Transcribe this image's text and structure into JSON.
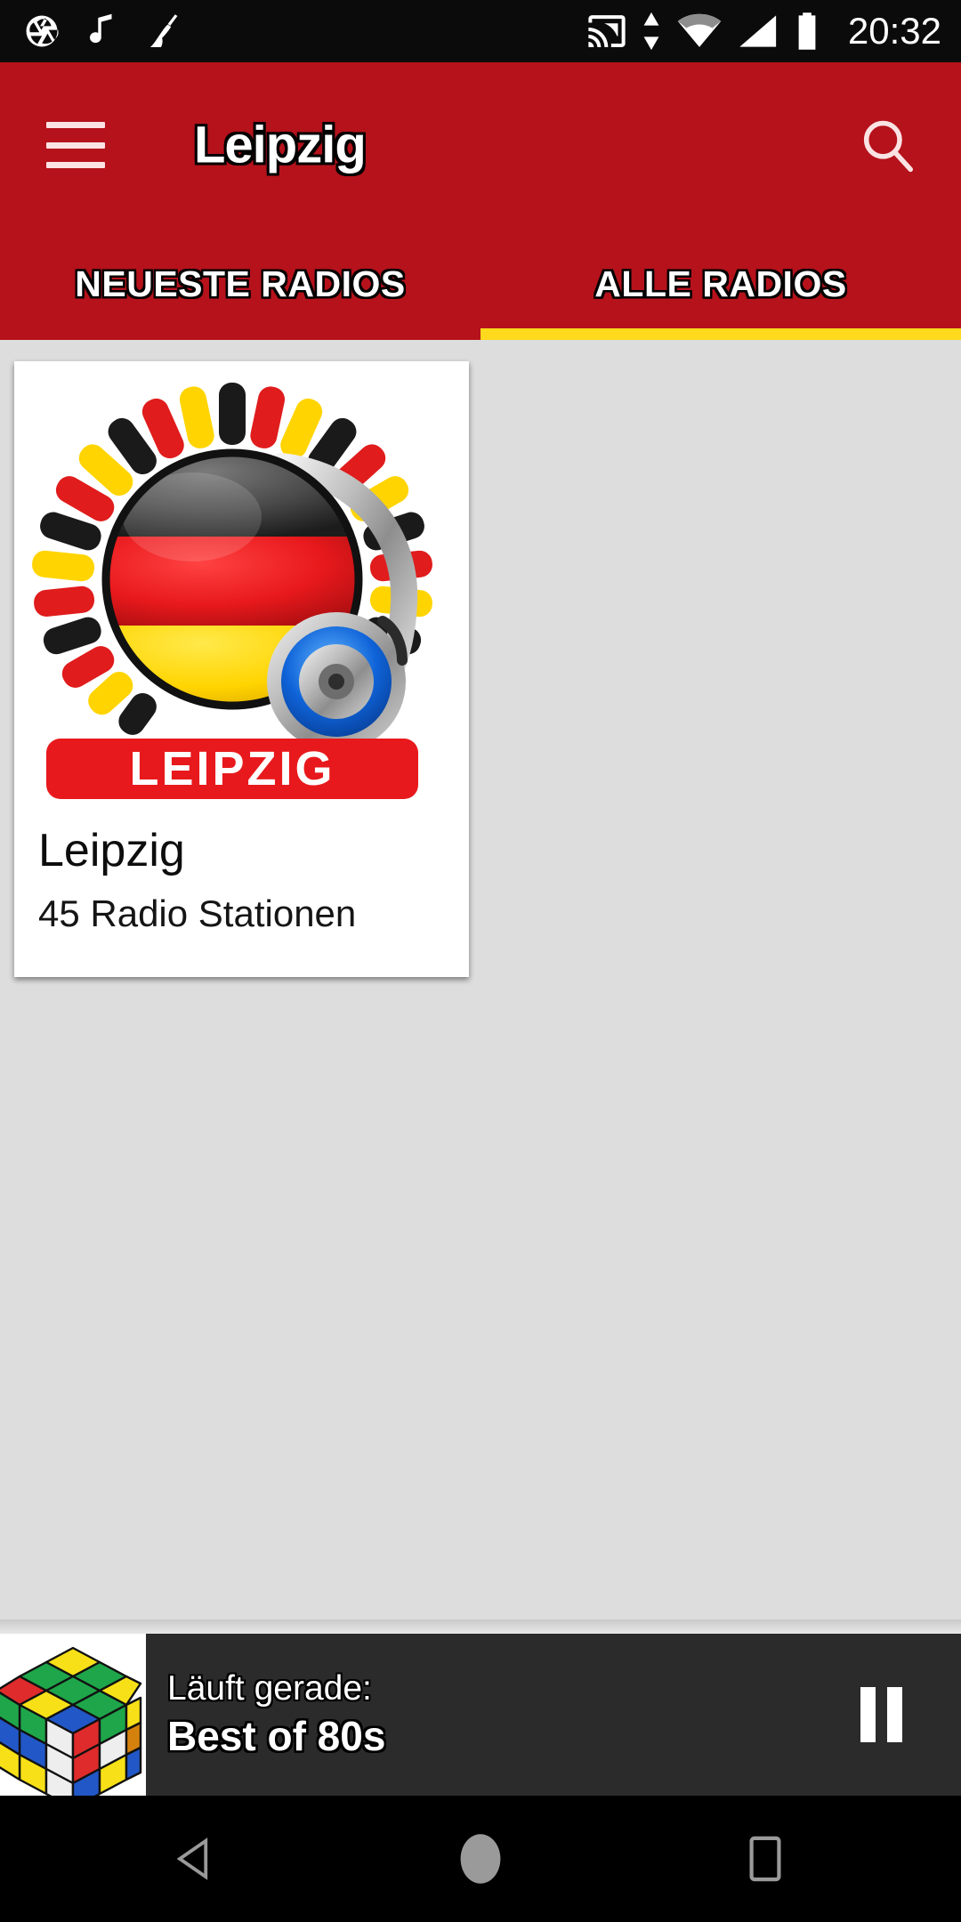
{
  "statusbar": {
    "left_icons": [
      "camera-aperture-icon",
      "music-note-icon",
      "broom-cleaner-icon"
    ],
    "right_icons": [
      "cast-icon",
      "data-transfer-arrows-icon",
      "wifi-icon",
      "cellular-signal-icon",
      "battery-icon"
    ],
    "time": "20:32",
    "background": "#0b0b0b"
  },
  "appbar": {
    "menu_icon": "hamburger-menu-icon",
    "title": "Leipzig",
    "search_icon": "search-icon",
    "background": "#b5121b",
    "title_color": "#ffffff"
  },
  "tabs": {
    "items": [
      {
        "label": "NEUESTE RADIOS",
        "active": false
      },
      {
        "label": "ALLE RADIOS",
        "active": true
      }
    ],
    "indicator_color": "#ffd91c"
  },
  "content": {
    "background": "#dddddd",
    "cards": [
      {
        "artwork": "leipzig-radio-logo",
        "artwork_banner_text": "LEIPZIG",
        "title": "Leipzig",
        "subtitle": "45 Radio Stationen"
      }
    ]
  },
  "player": {
    "thumbnail": "rubiks-cube-thumbnail",
    "now_playing_label": "Läuft gerade:",
    "track_title": "Best of 80s",
    "control_icon": "pause-icon",
    "background": "#2b2b2b"
  },
  "navbar": {
    "buttons": [
      {
        "name": "back",
        "icon": "back-triangle-icon"
      },
      {
        "name": "home",
        "icon": "home-circle-icon"
      },
      {
        "name": "recents",
        "icon": "recents-square-icon"
      }
    ],
    "background": "#000000",
    "icon_color": "#9a9a9a"
  }
}
